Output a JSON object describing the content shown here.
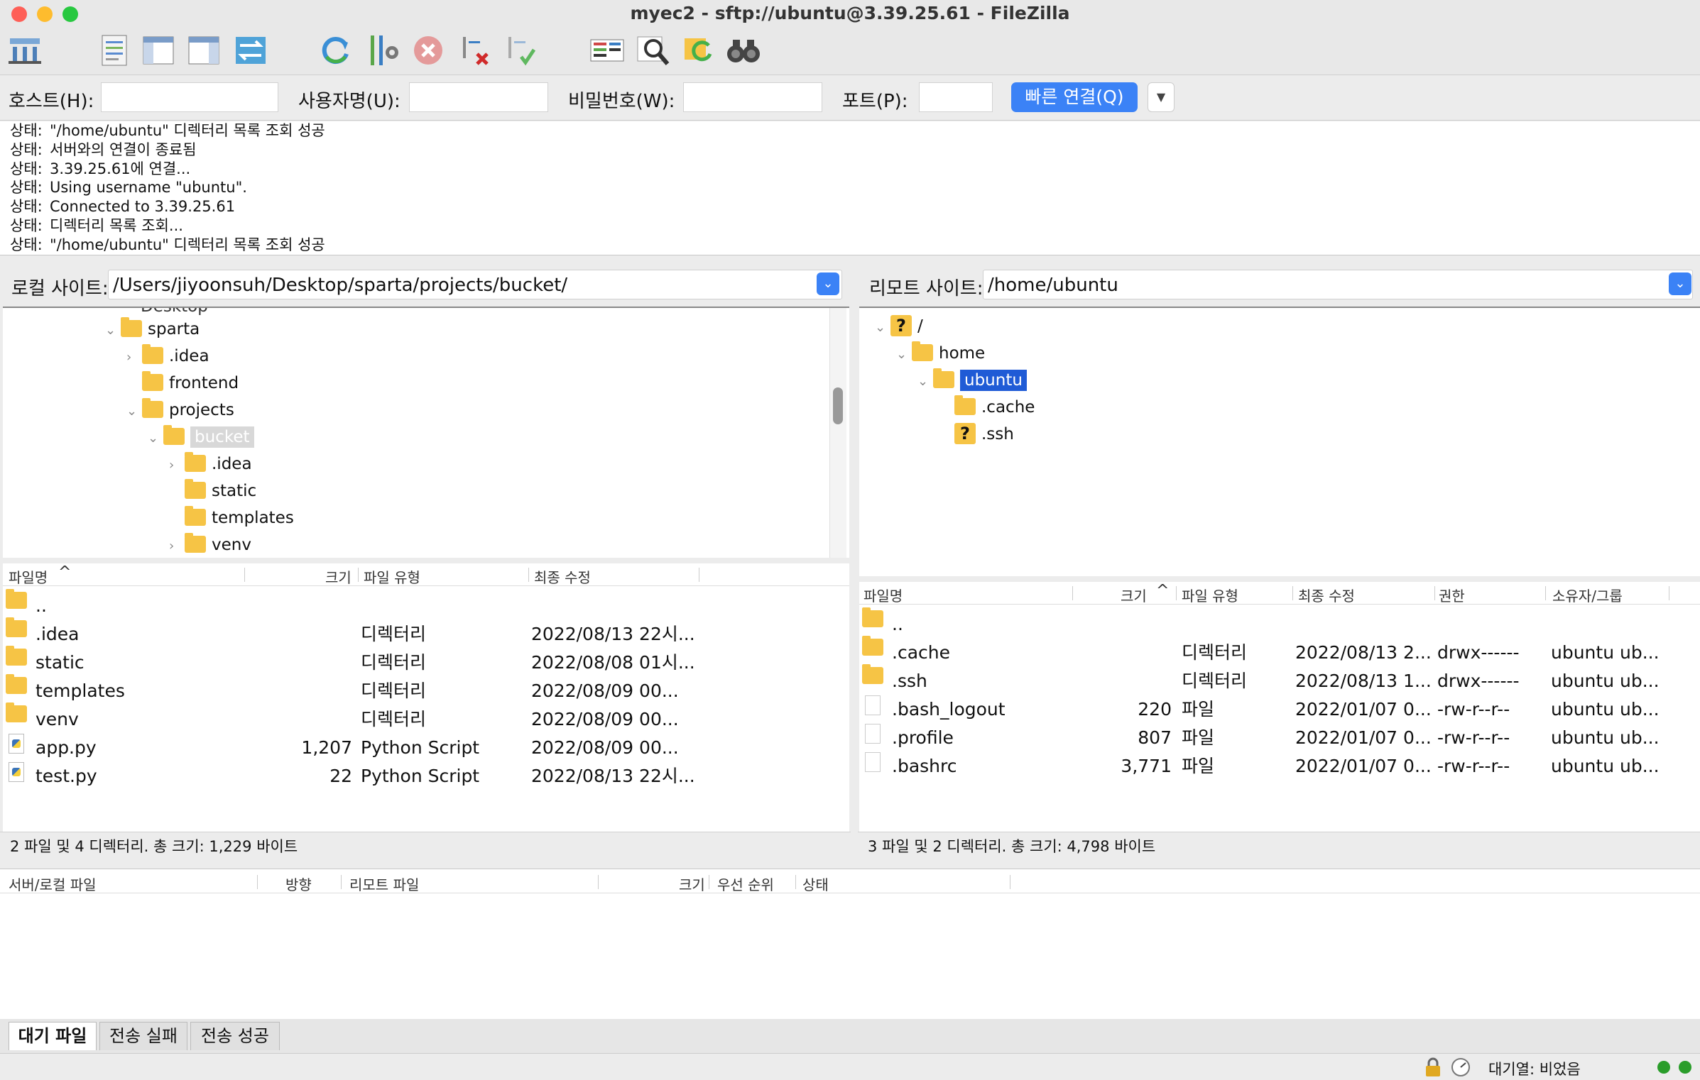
{
  "window": {
    "title": "myec2 - sftp://ubuntu@3.39.25.61 - FileZilla"
  },
  "toolbar": {
    "icons": [
      "site-manager-icon",
      "message-log-icon",
      "local-tree-icon",
      "remote-tree-icon",
      "transfer-queue-icon",
      "refresh-icon",
      "filter-icon",
      "cancel-icon",
      "disconnect-icon",
      "reconnect-icon",
      "directory-compare-icon",
      "search-remote-icon",
      "sync-browse-icon",
      "find-files-icon"
    ]
  },
  "quickconnect": {
    "host_label": "호스트(H):",
    "user_label": "사용자명(U):",
    "pass_label": "비밀번호(W):",
    "port_label": "포트(P):",
    "connect_label": "빠른 연결(Q)",
    "host_value": "",
    "user_value": "",
    "pass_value": "",
    "port_value": ""
  },
  "log": [
    {
      "k": "상태:",
      "v": "\"/home/ubuntu\" 디렉터리 목록 조회 성공"
    },
    {
      "k": "상태:",
      "v": "서버와의 연결이 종료됨"
    },
    {
      "k": "상태:",
      "v": "3.39.25.61에 연결..."
    },
    {
      "k": "상태:",
      "v": "Using username \"ubuntu\"."
    },
    {
      "k": "상태:",
      "v": "Connected to 3.39.25.61"
    },
    {
      "k": "상태:",
      "v": "디렉터리 목록 조회..."
    },
    {
      "k": "상태:",
      "v": "\"/home/ubuntu\" 디렉터리 목록 조회 성공"
    }
  ],
  "local": {
    "site_label": "로컬 사이트:",
    "path": "/Users/jiyoonsuh/Desktop/sparta/projects/bucket/",
    "tree_partial": "Desktop",
    "tree": [
      {
        "label": "sparta",
        "arrow": "⌄"
      },
      {
        "label": ".idea",
        "arrow": "›"
      },
      {
        "label": "frontend",
        "arrow": ""
      },
      {
        "label": "projects",
        "arrow": "⌄"
      },
      {
        "label": "bucket",
        "arrow": "⌄"
      },
      {
        "label": ".idea",
        "arrow": "›"
      },
      {
        "label": "static",
        "arrow": ""
      },
      {
        "label": "templates",
        "arrow": ""
      },
      {
        "label": "venv",
        "arrow": "›"
      }
    ],
    "columns": [
      "파일명",
      "크기",
      "파일 유형",
      "최종 수정"
    ],
    "files": [
      {
        "name": "..",
        "size": "",
        "type": "",
        "modified": "",
        "kind": "folder"
      },
      {
        "name": ".idea",
        "size": "",
        "type": "디렉터리",
        "modified": "2022/08/13 22시...",
        "kind": "folder"
      },
      {
        "name": "static",
        "size": "",
        "type": "디렉터리",
        "modified": "2022/08/08 01시...",
        "kind": "folder"
      },
      {
        "name": "templates",
        "size": "",
        "type": "디렉터리",
        "modified": "2022/08/09 00...",
        "kind": "folder"
      },
      {
        "name": "venv",
        "size": "",
        "type": "디렉터리",
        "modified": "2022/08/09 00...",
        "kind": "folder"
      },
      {
        "name": "app.py",
        "size": "1,207",
        "type": "Python Script",
        "modified": "2022/08/09 00...",
        "kind": "py"
      },
      {
        "name": "test.py",
        "size": "22",
        "type": "Python Script",
        "modified": "2022/08/13 22시...",
        "kind": "py"
      }
    ],
    "status": "2 파일 및 4 디렉터리. 총 크기: 1,229 바이트"
  },
  "remote": {
    "site_label": "리모트 사이트:",
    "path": "/home/ubuntu",
    "tree": [
      {
        "label": "/",
        "arrow": "⌄",
        "icon": "q"
      },
      {
        "label": "home",
        "arrow": "⌄",
        "icon": "folder"
      },
      {
        "label": "ubuntu",
        "arrow": "⌄",
        "icon": "folder"
      },
      {
        "label": ".cache",
        "arrow": "",
        "icon": "folder"
      },
      {
        "label": ".ssh",
        "arrow": "",
        "icon": "q"
      }
    ],
    "columns": [
      "파일명",
      "크기",
      "파일 유형",
      "최종 수정",
      "권한",
      "소유자/그룹"
    ],
    "files": [
      {
        "name": "..",
        "size": "",
        "type": "",
        "modified": "",
        "perm": "",
        "owner": "",
        "kind": "folder"
      },
      {
        "name": ".cache",
        "size": "",
        "type": "디렉터리",
        "modified": "2022/08/13 2...",
        "perm": "drwx------",
        "owner": "ubuntu ub...",
        "kind": "folder"
      },
      {
        "name": ".ssh",
        "size": "",
        "type": "디렉터리",
        "modified": "2022/08/13 1...",
        "perm": "drwx------",
        "owner": "ubuntu ub...",
        "kind": "folder"
      },
      {
        "name": ".bash_logout",
        "size": "220",
        "type": "파일",
        "modified": "2022/01/07 0...",
        "perm": "-rw-r--r--",
        "owner": "ubuntu ub...",
        "kind": "doc"
      },
      {
        "name": ".profile",
        "size": "807",
        "type": "파일",
        "modified": "2022/01/07 0...",
        "perm": "-rw-r--r--",
        "owner": "ubuntu ub...",
        "kind": "doc"
      },
      {
        "name": ".bashrc",
        "size": "3,771",
        "type": "파일",
        "modified": "2022/01/07 0...",
        "perm": "-rw-r--r--",
        "owner": "ubuntu ub...",
        "kind": "doc"
      }
    ],
    "status": "3 파일 및 2 디렉터리. 총 크기: 4,798 바이트"
  },
  "queue": {
    "columns": [
      "서버/로컬 파일",
      "방향",
      "리모트 파일",
      "크기",
      "우선 순위",
      "상태"
    ]
  },
  "tabs": [
    "대기 파일",
    "전송 실패",
    "전송 성공"
  ],
  "statusbar": {
    "queue_text": "대기열: 비었음"
  },
  "colors": {
    "accent": "#3b82f6",
    "selection": "#1f5bd6",
    "folder": "#f6c445"
  }
}
